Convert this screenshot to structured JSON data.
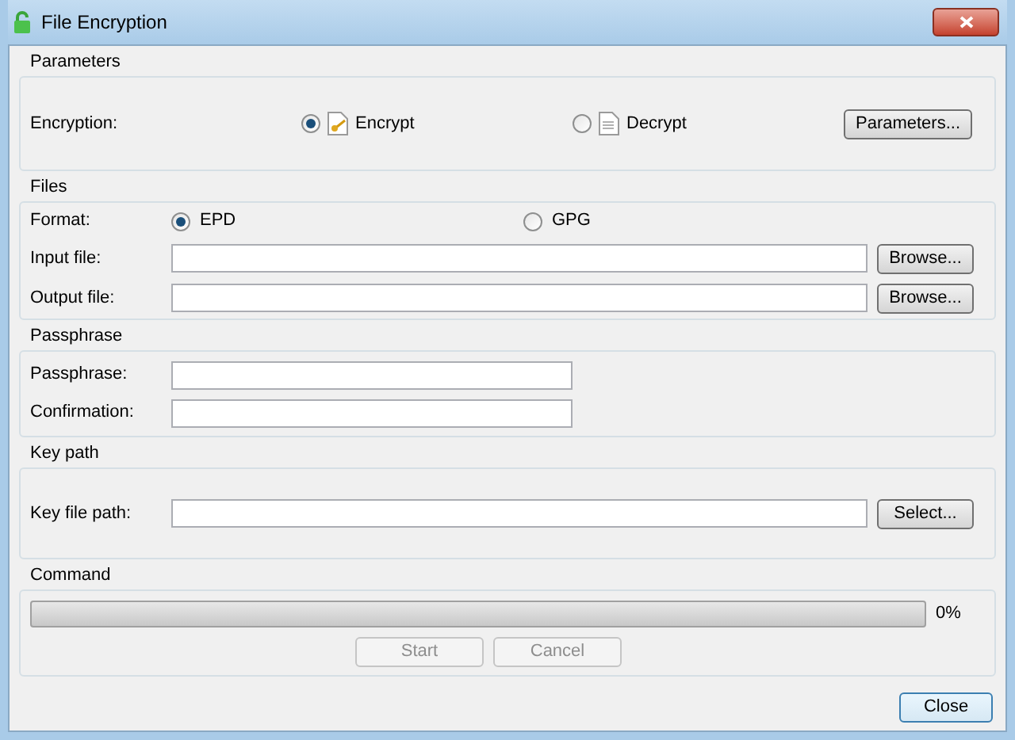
{
  "window": {
    "title": "File Encryption"
  },
  "parameters": {
    "title": "Parameters",
    "label": "Encryption:",
    "options": [
      {
        "label": "Encrypt",
        "selected": true,
        "kind": "encrypt"
      },
      {
        "label": "Decrypt",
        "selected": false,
        "kind": "decrypt"
      }
    ],
    "button": "Parameters..."
  },
  "files": {
    "title": "Files",
    "format_label": "Format:",
    "formats": [
      {
        "label": "EPD",
        "selected": true
      },
      {
        "label": "GPG",
        "selected": false
      }
    ],
    "fields": [
      {
        "label": "Input file:",
        "button": "Browse..."
      },
      {
        "label": "Output file:",
        "button": "Browse..."
      }
    ]
  },
  "passphrase": {
    "title": "Passphrase",
    "fields": [
      {
        "label": "Passphrase:"
      },
      {
        "label": "Confirmation:"
      }
    ]
  },
  "key_path": {
    "title": "Key path",
    "label": "Key file path:",
    "button": "Select..."
  },
  "command": {
    "title": "Command",
    "progress": {
      "level": 0,
      "reading": "0%"
    },
    "buttons": [
      {
        "label": "Start",
        "disabled": true
      },
      {
        "label": "Cancel",
        "disabled": true
      }
    ]
  },
  "close_button": "Close"
}
